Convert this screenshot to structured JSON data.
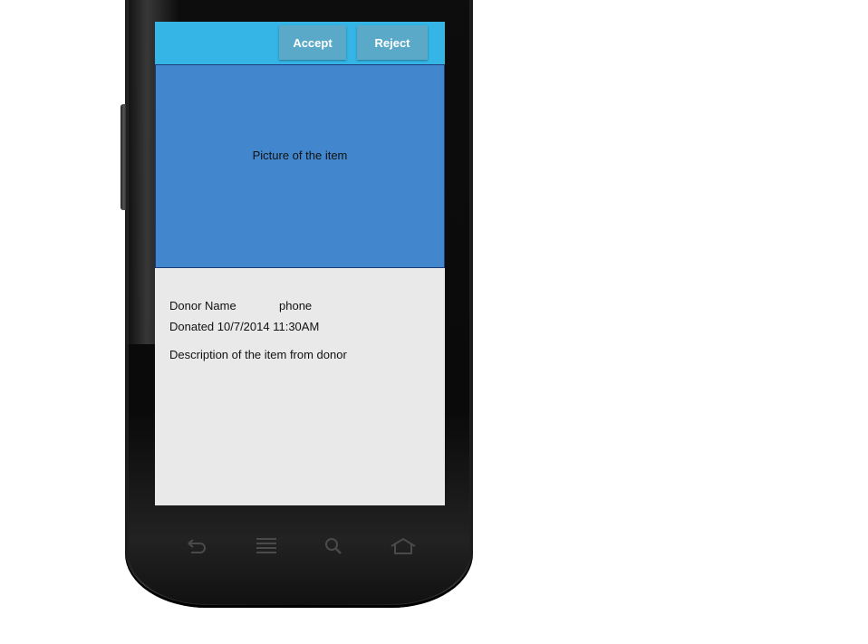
{
  "toolbar": {
    "accept_label": "Accept",
    "reject_label": "Reject",
    "bar_color": "#34b5e5"
  },
  "item": {
    "picture_text": "Picture of the item",
    "donor_name": "Donor Name",
    "phone": "phone",
    "donated": "Donated 10/7/2014 11:30AM",
    "description": "Description of the item from donor"
  },
  "device_nav": {
    "icons": [
      "back-icon",
      "menu-icon",
      "search-icon",
      "home-icon"
    ]
  }
}
